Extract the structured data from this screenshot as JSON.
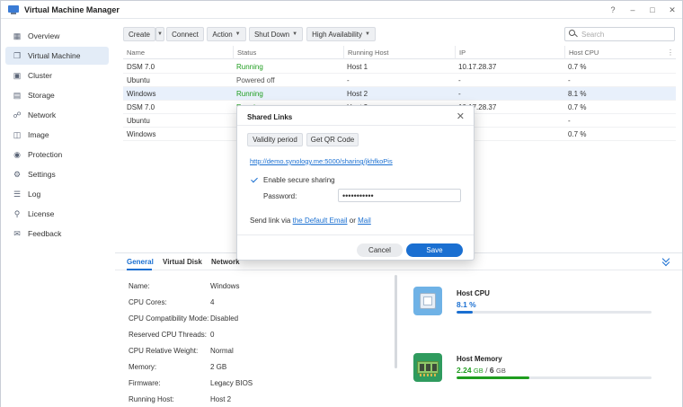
{
  "window": {
    "title": "Virtual Machine Manager",
    "controls": {
      "help": "?",
      "minimize": "–",
      "maximize": "□",
      "close": "✕"
    }
  },
  "sidebar": {
    "items": [
      {
        "label": "Overview",
        "icon": "overview-icon"
      },
      {
        "label": "Virtual Machine",
        "icon": "virtual-machine-icon",
        "active": true
      },
      {
        "label": "Cluster",
        "icon": "cluster-icon"
      },
      {
        "label": "Storage",
        "icon": "storage-icon"
      },
      {
        "label": "Network",
        "icon": "network-icon"
      },
      {
        "label": "Image",
        "icon": "image-icon"
      },
      {
        "label": "Protection",
        "icon": "protection-icon"
      },
      {
        "label": "Settings",
        "icon": "settings-icon"
      },
      {
        "label": "Log",
        "icon": "log-icon"
      },
      {
        "label": "License",
        "icon": "license-icon"
      },
      {
        "label": "Feedback",
        "icon": "feedback-icon"
      }
    ]
  },
  "toolbar": {
    "create": "Create",
    "connect": "Connect",
    "action": "Action",
    "shutdown": "Shut Down",
    "high_availability": "High Availability"
  },
  "search": {
    "placeholder": "Search"
  },
  "table": {
    "columns": [
      "Name",
      "Status",
      "Running Host",
      "IP",
      "Host CPU"
    ],
    "rows": [
      {
        "name": "DSM 7.0",
        "status": "Running",
        "host": "Host 1",
        "ip": "10.17.28.37",
        "cpu": "0.7 %"
      },
      {
        "name": "Ubuntu",
        "status": "Powered off",
        "host": "-",
        "ip": "-",
        "cpu": "-"
      },
      {
        "name": "Windows",
        "status": "Running",
        "host": "Host 2",
        "ip": "-",
        "cpu": "8.1 %"
      },
      {
        "name": "DSM 7.0",
        "status": "Running",
        "host": "Host 2",
        "ip": "10.17.28.37",
        "cpu": "0.7 %"
      },
      {
        "name": "Ubuntu",
        "status": "",
        "host": "",
        "ip": "",
        "cpu": "-"
      },
      {
        "name": "Windows",
        "status": "",
        "host": "",
        "ip": "",
        "cpu": "0.7 %"
      }
    ]
  },
  "bottom": {
    "tabs": [
      "General",
      "Virtual Disk",
      "Network"
    ],
    "info": [
      {
        "key": "Name:",
        "value": "Windows"
      },
      {
        "key": "CPU Cores:",
        "value": "4"
      },
      {
        "key": "CPU Compatibility Mode:",
        "value": "Disabled"
      },
      {
        "key": "Reserved CPU Threads:",
        "value": "0"
      },
      {
        "key": "CPU Relative Weight:",
        "value": "Normal"
      },
      {
        "key": "Memory:",
        "value": "2 GB"
      },
      {
        "key": "Firmware:",
        "value": "Legacy BIOS"
      },
      {
        "key": "Running Host:",
        "value": "Host 2"
      }
    ],
    "host_cpu": {
      "title": "Host CPU",
      "value": "8.1 %",
      "percent": 8.1,
      "color": "#1a6fd1"
    },
    "host_memory": {
      "title": "Host Memory",
      "used": "2.24",
      "used_unit": "GB",
      "sep": "/",
      "total": "6",
      "total_unit": "GB",
      "fraction": 0.373,
      "color": "#1f9d1f"
    }
  },
  "dialog": {
    "title": "Shared Links",
    "close": "✕",
    "validity_btn": "Validity period",
    "qr_btn": "Get QR Code",
    "link": "http://demo.synology.me:5000/sharing/jkhfkoPis",
    "secure_label": "Enable secure sharing",
    "secure_checked": true,
    "password_label": "Password:",
    "password_value": "•••••••••••",
    "send_prefix": "Send link via",
    "send_email": "the Default Email",
    "send_or": "or",
    "send_mail": "Mail",
    "cancel": "Cancel",
    "save": "Save"
  }
}
